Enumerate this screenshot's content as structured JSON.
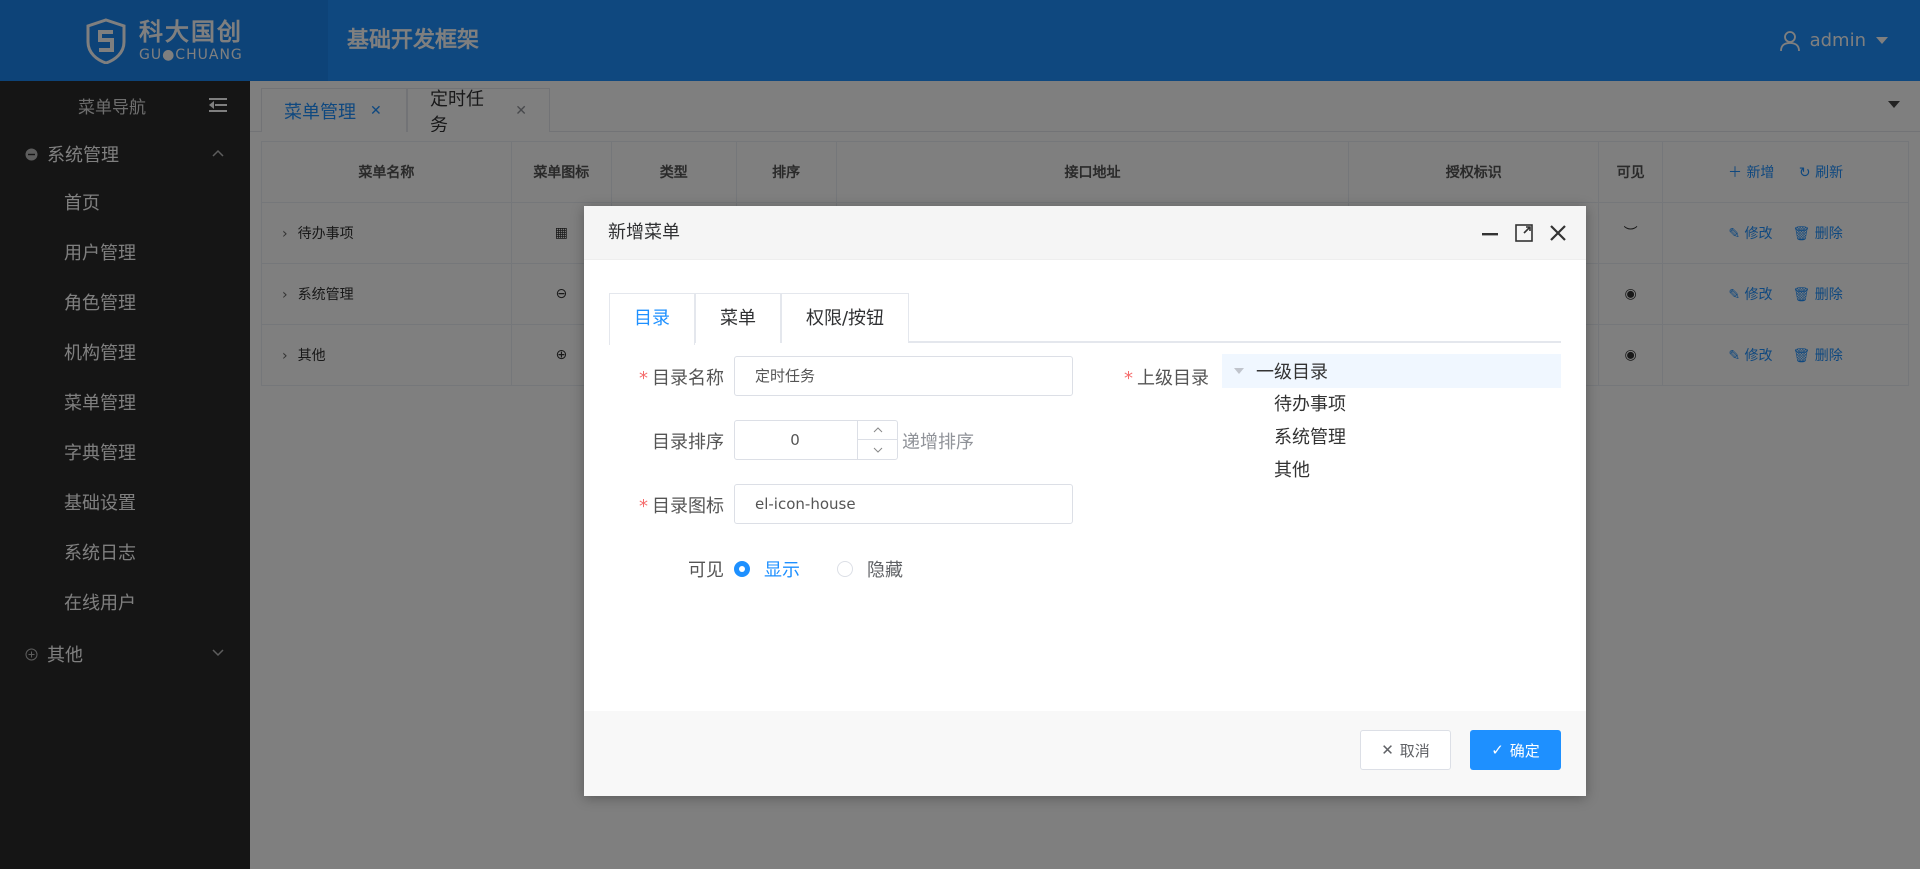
{
  "header": {
    "logo_cn": "科大国创",
    "logo_en": "GU●CHUANG",
    "title": "基础开发框架",
    "user": "admin"
  },
  "sidebar": {
    "title": "菜单导航",
    "groups": [
      {
        "label": "系统管理",
        "expanded": true,
        "items": [
          "首页",
          "用户管理",
          "角色管理",
          "机构管理",
          "菜单管理",
          "字典管理",
          "基础设置",
          "系统日志",
          "在线用户"
        ]
      },
      {
        "label": "其他",
        "expanded": false,
        "items": []
      }
    ]
  },
  "tabs": [
    {
      "label": "菜单管理",
      "active": true
    },
    {
      "label": "定时任务",
      "active": false
    }
  ],
  "table": {
    "headers": [
      "菜单名称",
      "菜单图标",
      "类型",
      "排序",
      "接口地址",
      "授权标识",
      "可见"
    ],
    "actions": {
      "add": "新增",
      "refresh": "刷新",
      "edit": "修改",
      "delete": "删除"
    },
    "rows": [
      {
        "name": "待办事项",
        "icon": "grid-icon"
      },
      {
        "name": "系统管理",
        "icon": "minus-circle-icon"
      },
      {
        "name": "其他",
        "icon": "plus-circle-icon"
      }
    ]
  },
  "dialog": {
    "title": "新增菜单",
    "tabs": [
      "目录",
      "菜单",
      "权限/按钮"
    ],
    "form": {
      "name_label": "目录名称",
      "name_value": "定时任务",
      "order_label": "目录排序",
      "order_value": "0",
      "order_hint": "递增排序",
      "icon_label": "目录图标",
      "icon_value": "el-icon-house",
      "visible_label": "可见",
      "visible_show": "显示",
      "visible_hide": "隐藏",
      "parent_label": "上级目录"
    },
    "tree": {
      "root": "一级目录",
      "children": [
        "待办事项",
        "系统管理",
        "其他"
      ]
    },
    "buttons": {
      "cancel": "取消",
      "ok": "确定"
    }
  },
  "colors": {
    "primary": "#1e90ff",
    "sidebar": "#2b2b2b",
    "required": "#f56c6c"
  }
}
